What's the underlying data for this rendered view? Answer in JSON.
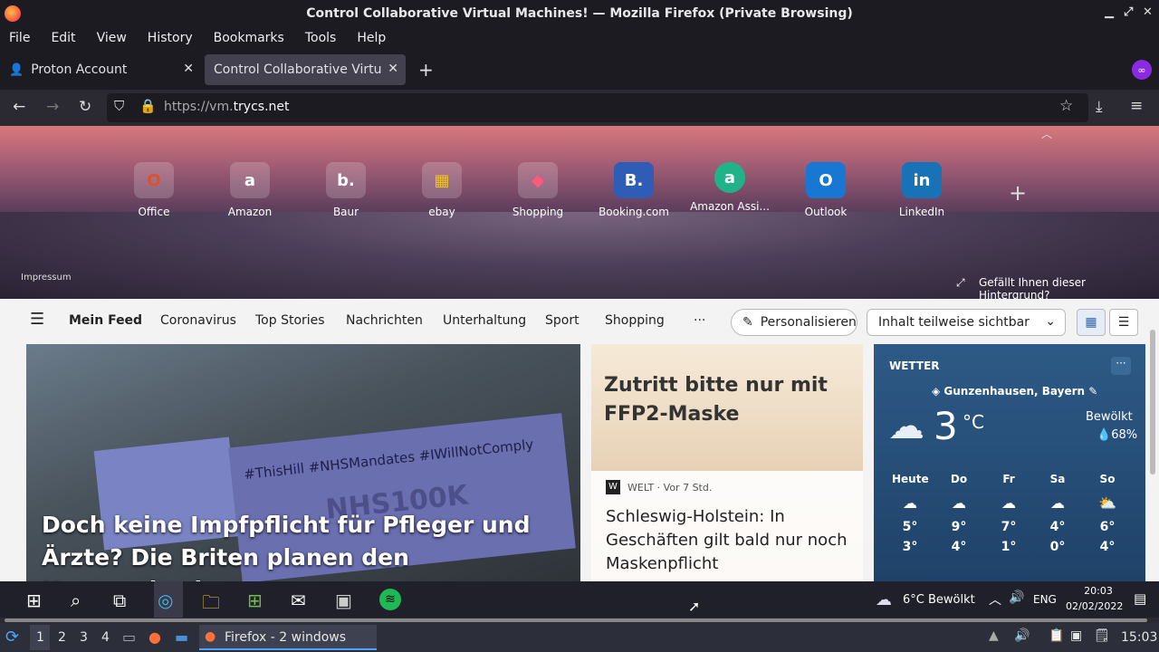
{
  "window": {
    "title": "Control Collaborative Virtual Machines! — Mozilla Firefox (Private Browsing)"
  },
  "menu": [
    "File",
    "Edit",
    "View",
    "History",
    "Bookmarks",
    "Tools",
    "Help"
  ],
  "tabs": [
    {
      "label": "Proton Account",
      "active": false
    },
    {
      "label": "Control Collaborative Virtual",
      "active": true
    }
  ],
  "url": {
    "prefix": "https://vm.",
    "domain": "trycs.net"
  },
  "tiles": [
    {
      "label": "Office",
      "glyph": "O",
      "color": "#e0502b"
    },
    {
      "label": "Amazon",
      "glyph": "a",
      "color": "#ffffff"
    },
    {
      "label": "Baur",
      "glyph": "b.",
      "color": "#ffffff"
    },
    {
      "label": "ebay",
      "glyph": "▦",
      "color": "#f0c419"
    },
    {
      "label": "Shopping",
      "glyph": "◆",
      "color": "#ff5a7a"
    },
    {
      "label": "Booking.com",
      "glyph": "B.",
      "color": "#2f5db5"
    },
    {
      "label": "Amazon Assi...",
      "glyph": "a",
      "color": "#20b38a"
    },
    {
      "label": "Outlook",
      "glyph": "O",
      "color": "#1877d2"
    },
    {
      "label": "LinkedIn",
      "glyph": "in",
      "color": "#1772b7"
    }
  ],
  "hero": {
    "impressum": "Impressum",
    "bg_question": "Gefällt Ihnen dieser Hintergrund?"
  },
  "feed_nav": {
    "items": [
      "Mein Feed",
      "Coronavirus",
      "Top Stories",
      "Nachrichten",
      "Unterhaltung",
      "Sport",
      "Shopping"
    ],
    "more": "···",
    "personalize": "Personalisieren",
    "visibility": "Inhalt teilweise sichtbar"
  },
  "card1": {
    "headline": "Doch keine Impfpflicht für Pfleger und Ärzte? Die Briten planen den Kurswechsel",
    "sign_text": "#ThisHill  #NHSMandates  #IWillNotComply",
    "sign2": "NHS100K"
  },
  "card2": {
    "image_text": "Zutritt bitte nur mit FFP2-Maske",
    "source": "WELT · Vor 7 Std.",
    "source_badge": "W",
    "headline": "Schleswig-Holstein: In Geschäften gilt bald nur noch Maskenpflicht"
  },
  "weather": {
    "heading": "WETTER",
    "location": "Gunzenhausen, Bayern",
    "temp": "3",
    "unit": "°C",
    "condition": "Bewölkt",
    "humidity": "68%",
    "days": [
      {
        "name": "Heute",
        "high": "5°",
        "low": "3°",
        "icon": "☁"
      },
      {
        "name": "Do",
        "high": "9°",
        "low": "4°",
        "icon": "☁"
      },
      {
        "name": "Fr",
        "high": "7°",
        "low": "1°",
        "icon": "☁"
      },
      {
        "name": "Sa",
        "high": "4°",
        "low": "0°",
        "icon": "☁"
      },
      {
        "name": "So",
        "high": "6°",
        "low": "4°",
        "icon": "⛅"
      }
    ]
  },
  "taskbar": {
    "weather": "6°C  Bewölkt",
    "lang": "ENG",
    "time": "20:03",
    "date": "02/02/2022"
  },
  "panel": {
    "workspaces": [
      "1",
      "2",
      "3",
      "4"
    ],
    "window_label": "Firefox - 2 windows",
    "clock": "15:03"
  }
}
